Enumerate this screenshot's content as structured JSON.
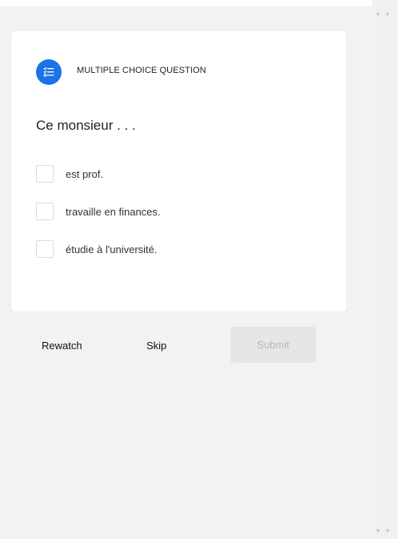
{
  "question_card": {
    "type_label": "MULTIPLE CHOICE QUESTION",
    "type_icon": "checklist-icon",
    "question_text": "Ce monsieur . . .",
    "options": [
      {
        "label": "est prof.",
        "checked": false
      },
      {
        "label": "travaille en finances.",
        "checked": false
      },
      {
        "label": "étudie à l'université.",
        "checked": false
      }
    ],
    "accent_color": "#1a73e8"
  },
  "actions": {
    "rewatch_label": "Rewatch",
    "skip_label": "Skip",
    "submit_label": "Submit",
    "submit_enabled": false
  },
  "scrollbar": {
    "up_icon": "scroll-up-icon",
    "down_icon": "scroll-down-icon"
  }
}
